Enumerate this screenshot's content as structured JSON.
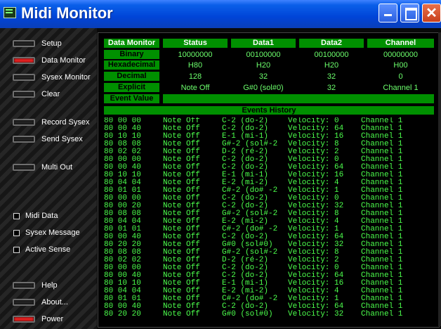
{
  "window": {
    "title": "Midi Monitor"
  },
  "sidebar": {
    "buttons": [
      {
        "label": "Setup",
        "on": false
      },
      {
        "label": "Data Monitor",
        "on": true
      },
      {
        "label": "Sysex Monitor",
        "on": false
      },
      {
        "label": "Clear",
        "on": false
      },
      {
        "label": "Record Sysex",
        "on": false
      },
      {
        "label": "Send Sysex",
        "on": false
      },
      {
        "label": "Multi Out",
        "on": false
      },
      {
        "label": "Help",
        "on": false
      },
      {
        "label": "About...",
        "on": false
      },
      {
        "label": "Power",
        "on": true
      }
    ],
    "checkboxes": [
      {
        "label": "Midi Data"
      },
      {
        "label": "Sysex Message"
      },
      {
        "label": "Active Sense"
      }
    ]
  },
  "monitor": {
    "corner": "Data Monitor",
    "columns": [
      "Status",
      "Data1",
      "Data2",
      "Channel"
    ],
    "rows": [
      {
        "label": "Binary",
        "values": [
          "10000000",
          "00100000",
          "00100000",
          "00000000"
        ]
      },
      {
        "label": "Hexadecimal",
        "values": [
          "H80",
          "H20",
          "H20",
          "H00"
        ]
      },
      {
        "label": "Decimal",
        "values": [
          "128",
          "32",
          "32",
          "0"
        ]
      },
      {
        "label": "Explicit",
        "values": [
          "Note Off",
          "G#0 (sol#0)",
          "32",
          "Channel 1"
        ]
      },
      {
        "label": "Event Value",
        "values": [
          "",
          "",
          "",
          ""
        ]
      }
    ],
    "history_title": "Events History",
    "history": [
      [
        "80 00 00",
        "Note Off",
        "C-2 (do-2)",
        "Velocity: 0",
        "Channel 1"
      ],
      [
        "80 00 40",
        "Note Off",
        "C-2 (do-2)",
        "Velocity: 64",
        "Channel 1"
      ],
      [
        "80 10 10",
        "Note Off",
        "E-1 (mi-1)",
        "Velocity: 16",
        "Channel 1"
      ],
      [
        "80 08 08",
        "Note Off",
        "G#-2 (sol#-2",
        "Velocity: 8",
        "Channel 1"
      ],
      [
        "80 02 02",
        "Note Off",
        "D-2 (ré-2)",
        "Velocity: 2",
        "Channel 1"
      ],
      [
        "80 00 00",
        "Note Off",
        "C-2 (do-2)",
        "Velocity: 0",
        "Channel 1"
      ],
      [
        "80 00 40",
        "Note Off",
        "C-2 (do-2)",
        "Velocity: 64",
        "Channel 1"
      ],
      [
        "80 10 10",
        "Note Off",
        "E-1 (mi-1)",
        "Velocity: 16",
        "Channel 1"
      ],
      [
        "80 04 04",
        "Note Off",
        "E-2 (mi-2)",
        "Velocity: 4",
        "Channel 1"
      ],
      [
        "80 01 01",
        "Note Off",
        "C#-2 (do# -2",
        "Velocity: 1",
        "Channel 1"
      ],
      [
        "80 00 00",
        "Note Off",
        "C-2 (do-2)",
        "Velocity: 0",
        "Channel 1"
      ],
      [
        "80 00 20",
        "Note Off",
        "C-2 (do-2)",
        "Velocity: 32",
        "Channel 1"
      ],
      [
        "80 08 08",
        "Note Off",
        "G#-2 (sol#-2",
        "Velocity: 8",
        "Channel 1"
      ],
      [
        "80 04 04",
        "Note Off",
        "E-2 (mi-2)",
        "Velocity: 4",
        "Channel 1"
      ],
      [
        "80 01 01",
        "Note Off",
        "C#-2 (do# -2",
        "Velocity: 1",
        "Channel 1"
      ],
      [
        "80 00 40",
        "Note Off",
        "C-2 (do-2)",
        "Velocity: 64",
        "Channel 1"
      ],
      [
        "80 20 20",
        "Note Off",
        "G#0 (sol#0)",
        "Velocity: 32",
        "Channel 1"
      ],
      [
        "80 08 08",
        "Note Off",
        "G#-2 (sol#-2",
        "Velocity: 8",
        "Channel 1"
      ],
      [
        "80 02 02",
        "Note Off",
        "D-2 (ré-2)",
        "Velocity: 2",
        "Channel 1"
      ],
      [
        "80 00 00",
        "Note Off",
        "C-2 (do-2)",
        "Velocity: 0",
        "Channel 1"
      ],
      [
        "80 00 40",
        "Note Off",
        "C-2 (do-2)",
        "Velocity: 64",
        "Channel 1"
      ],
      [
        "80 10 10",
        "Note Off",
        "E-1 (mi-1)",
        "Velocity: 16",
        "Channel 1"
      ],
      [
        "80 04 04",
        "Note Off",
        "E-2 (mi-2)",
        "Velocity: 4",
        "Channel 1"
      ],
      [
        "80 01 01",
        "Note Off",
        "C#-2 (do# -2",
        "Velocity: 1",
        "Channel 1"
      ],
      [
        "80 00 40",
        "Note Off",
        "C-2 (do-2)",
        "Velocity: 64",
        "Channel 1"
      ],
      [
        "80 20 20",
        "Note Off",
        "G#0 (sol#0)",
        "Velocity: 32",
        "Channel 1"
      ]
    ]
  }
}
